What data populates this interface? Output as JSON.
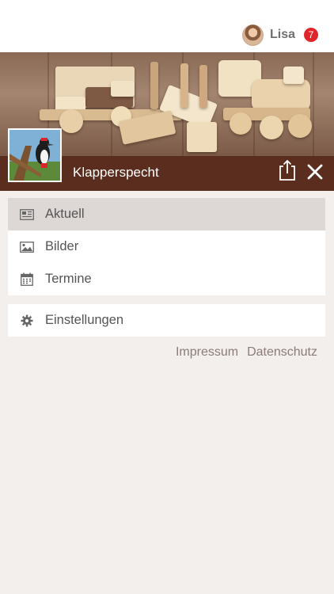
{
  "user": {
    "name": "Lisa",
    "notification_count": "7"
  },
  "header": {
    "title": "Klapperspecht",
    "share_icon": "share-icon",
    "close_icon": "close-icon"
  },
  "menu": {
    "items": [
      {
        "label": "Aktuell",
        "icon": "newspaper-icon",
        "active": true
      },
      {
        "label": "Bilder",
        "icon": "image-icon",
        "active": false
      },
      {
        "label": "Termine",
        "icon": "calendar-icon",
        "active": false
      }
    ],
    "settings": {
      "label": "Einstellungen",
      "icon": "gear-icon"
    }
  },
  "footer_links": {
    "impressum": "Impressum",
    "datenschutz": "Datenschutz"
  },
  "colors": {
    "title_bar": "#5a2d1e",
    "badge": "#e0262b",
    "active_item": "#ddd7d5",
    "background": "#f3efed"
  }
}
